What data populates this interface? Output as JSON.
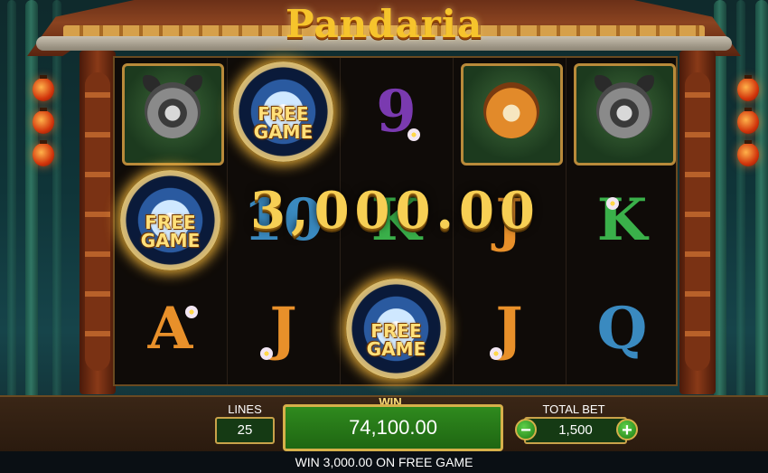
{
  "game": {
    "title": "Pandaria"
  },
  "reels": [
    [
      {
        "type": "symbol",
        "icon": "raccoon-icon"
      },
      {
        "type": "free-game",
        "label": "FREE GAME"
      },
      {
        "type": "letter",
        "value": "A",
        "color": "#e8902a"
      }
    ],
    [
      {
        "type": "free-game",
        "label": "FREE GAME"
      },
      {
        "type": "letter",
        "value": "10",
        "color": "#3a8ac0"
      },
      {
        "type": "letter",
        "value": "J",
        "color": "#e8902a"
      }
    ],
    [
      {
        "type": "letter",
        "value": "9",
        "color": "#7a3ab0"
      },
      {
        "type": "letter",
        "value": "K",
        "color": "#3ab04a"
      },
      {
        "type": "free-game",
        "label": "FREE GAME"
      }
    ],
    [
      {
        "type": "symbol",
        "icon": "tiger-icon"
      },
      {
        "type": "letter",
        "value": "J",
        "color": "#e8902a"
      },
      {
        "type": "letter",
        "value": "J",
        "color": "#e8902a"
      }
    ],
    [
      {
        "type": "symbol",
        "icon": "raccoon-icon"
      },
      {
        "type": "letter",
        "value": "K",
        "color": "#3ab04a"
      },
      {
        "type": "letter",
        "value": "Q",
        "color": "#3a8ac0"
      }
    ]
  ],
  "big_win_amount": "3,000.00",
  "controls": {
    "lines_label": "LINES",
    "lines_value": "25",
    "win_label": "WIN",
    "win_value": "74,100.00",
    "total_bet_label": "TOTAL BET",
    "total_bet_value": "1,500",
    "minus_symbol": "−",
    "plus_symbol": "+"
  },
  "message": "WIN 3,000.00 ON FREE GAME"
}
